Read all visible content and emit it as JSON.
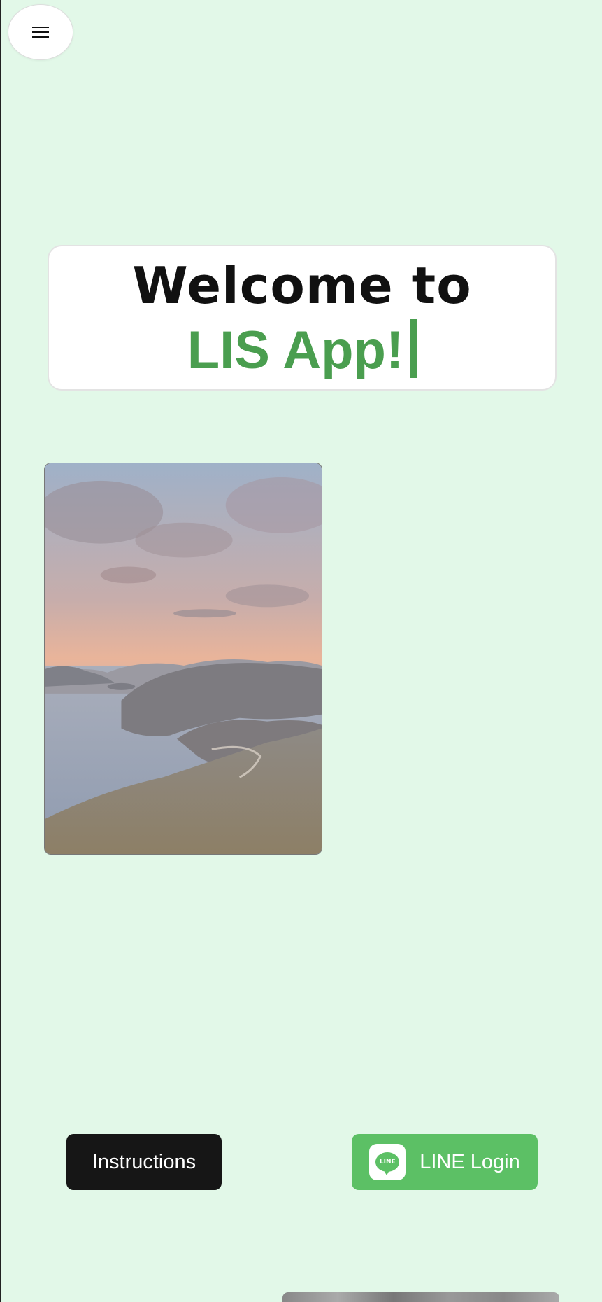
{
  "header": {
    "menu_icon": "hamburger-icon"
  },
  "welcome": {
    "line1": "Welcome to",
    "line2": "LIS App!",
    "accent_color": "#4a9e4f"
  },
  "hero_image": {
    "alt": "coastal-sunset-photo"
  },
  "actions": {
    "instructions_label": "Instructions",
    "line_login_label": "LINE Login",
    "line_badge_text": "LINE",
    "line_color": "#5cc065"
  },
  "colors": {
    "background": "#e2f8e8",
    "instructions_bg": "#161616"
  }
}
